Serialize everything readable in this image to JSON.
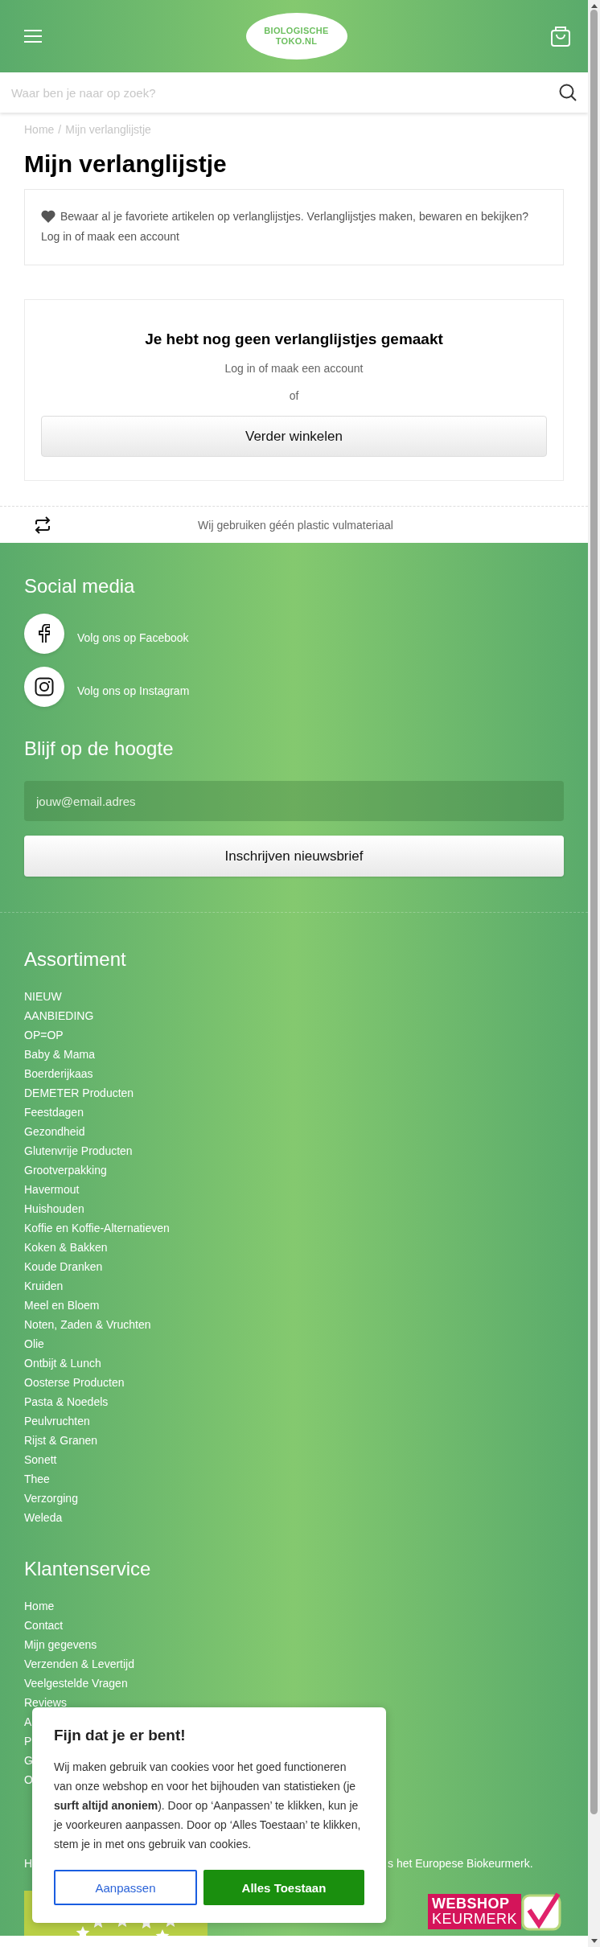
{
  "header": {
    "logo": [
      "BIOLOGISCHE",
      "TOKO.NL"
    ],
    "search_placeholder": "Waar ben je naar op zoek?"
  },
  "breadcrumb": {
    "items": [
      "Home",
      "Mijn verlanglijstje"
    ],
    "separator": "/"
  },
  "title": "Mijn verlanglijstje",
  "info": {
    "text": "Bewaar al je favoriete artikelen op verlanglijstjes. Verlanglijstjes maken, bewaren en bekijken?",
    "link": "Log in of maak een account"
  },
  "empty": {
    "heading": "Je hebt nog geen verlanglijstjes gemaakt",
    "login": "Log in of maak een account",
    "or": "of",
    "button": "Verder winkelen"
  },
  "usp": "Wij gebruiken géén plastic vulmateriaal",
  "social": {
    "heading": "Social media",
    "links": [
      {
        "kind": "facebook",
        "label": "Volg ons op Facebook"
      },
      {
        "kind": "instagram",
        "label": "Volg ons op Instagram"
      }
    ]
  },
  "newsletter": {
    "heading": "Blijf op de hoogte",
    "placeholder": "jouw@email.adres",
    "button": "Inschrijven nieuwsbrief"
  },
  "assortiment": {
    "heading": "Assortiment",
    "items": [
      "NIEUW",
      "AANBIEDING",
      "OP=OP",
      "Baby & Mama",
      "Boerderijkaas",
      "DEMETER Producten",
      "Feestdagen",
      "Gezondheid",
      "Glutenvrije Producten",
      "Grootverpakking",
      "Havermout",
      "Huishouden",
      "Koffie en Koffie-Alternatieven",
      "Koken & Bakken",
      "Koude Dranken",
      "Kruiden",
      "Meel en Bloem",
      "Noten, Zaden & Vruchten",
      "Olie",
      "Ontbijt & Lunch",
      "Oosterse Producten",
      "Pasta & Noedels",
      "Peulvruchten",
      "Rijst & Granen",
      "Sonett",
      "Thee",
      "Verzorging",
      "Weleda"
    ]
  },
  "service": {
    "heading": "Klantenservice",
    "items": [
      "Home",
      "Contact",
      "Mijn gegevens",
      "Verzenden & Levertijd",
      "Veelgestelde Vragen",
      "Reviews",
      "A",
      "P",
      "G",
      "O"
    ]
  },
  "certificate": {
    "text_start": "H",
    "text_end": "s het Europese Biokeurmerk."
  },
  "keurmerk": [
    "WEBSHOP",
    "KEURMERK"
  ],
  "cookie": {
    "title": "Fijn dat je er bent!",
    "body": "Wij maken gebruik van cookies voor het goed functioneren van onze webshop en voor het bijhouden van statistieken (je **surft altijd anoniem**). Door op ‘Aanpassen’ te klikken, kun je je voorkeuren aanpassen. Door op ‘Alles Toestaan’ te klikken, stem je in met ons gebruik van cookies.",
    "buttons": [
      {
        "kind": "secondary",
        "label": "Aanpassen"
      },
      {
        "kind": "primary",
        "label": "Alles Toestaan"
      }
    ]
  }
}
